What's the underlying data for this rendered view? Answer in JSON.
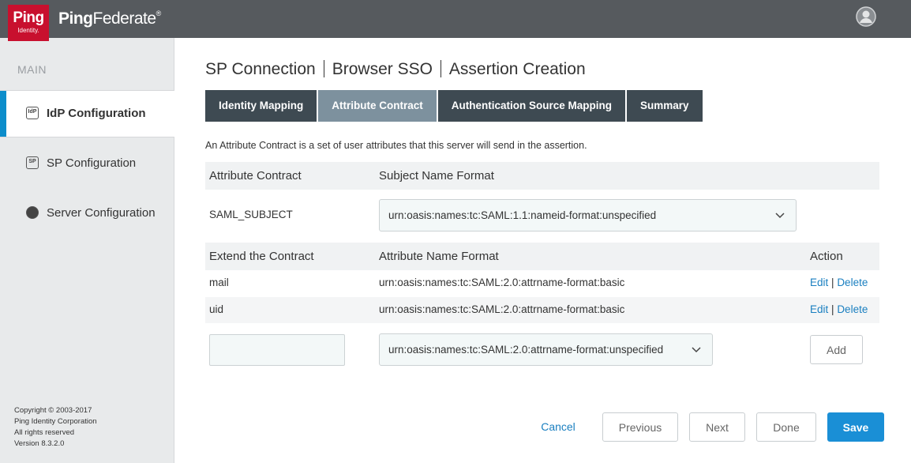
{
  "header": {
    "logo_top": "Ping",
    "logo_bottom": "Identity.",
    "brand_bold": "Ping",
    "brand_rest": "Federate",
    "brand_mark": "®",
    "user_icon": "user-avatar-icon"
  },
  "sidebar": {
    "title": "MAIN",
    "items": [
      {
        "label": "IdP Configuration",
        "icon_text": "IdP",
        "active": true
      },
      {
        "label": "SP Configuration",
        "icon_text": "SP",
        "active": false
      },
      {
        "label": "Server Configuration",
        "icon_text": "",
        "active": false
      }
    ],
    "copyright": [
      "Copyright © 2003-2017",
      "Ping Identity Corporation",
      "All rights reserved",
      "Version 8.3.2.0"
    ]
  },
  "breadcrumb": [
    "SP Connection",
    "Browser SSO",
    "Assertion Creation"
  ],
  "tabs": [
    {
      "label": "Identity Mapping",
      "active": false
    },
    {
      "label": "Attribute Contract",
      "active": true
    },
    {
      "label": "Authentication Source Mapping",
      "active": false
    },
    {
      "label": "Summary",
      "active": false
    }
  ],
  "description": "An Attribute Contract is a set of user attributes that this server will send in the assertion.",
  "contract": {
    "col1": "Attribute Contract",
    "col2": "Subject Name Format",
    "subject": "SAML_SUBJECT",
    "subject_format": "urn:oasis:names:tc:SAML:1.1:nameid-format:unspecified"
  },
  "extend": {
    "col1": "Extend the Contract",
    "col2": "Attribute Name Format",
    "col3": "Action",
    "rows": [
      {
        "name": "mail",
        "format": "urn:oasis:names:tc:SAML:2.0:attrname-format:basic",
        "edit": "Edit",
        "sep": "|",
        "delete": "Delete"
      },
      {
        "name": "uid",
        "format": "urn:oasis:names:tc:SAML:2.0:attrname-format:basic",
        "edit": "Edit",
        "sep": "|",
        "delete": "Delete"
      }
    ],
    "new_name_value": "",
    "new_format": "urn:oasis:names:tc:SAML:2.0:attrname-format:unspecified",
    "add_label": "Add"
  },
  "footer": {
    "cancel": "Cancel",
    "previous": "Previous",
    "next": "Next",
    "done": "Done",
    "save": "Save"
  },
  "colors": {
    "accent": "#1a8fd6",
    "brand_red": "#c8102e",
    "topbar": "#565a5e",
    "tab_dark": "#3e4a52",
    "tab_active": "#7d919e"
  }
}
